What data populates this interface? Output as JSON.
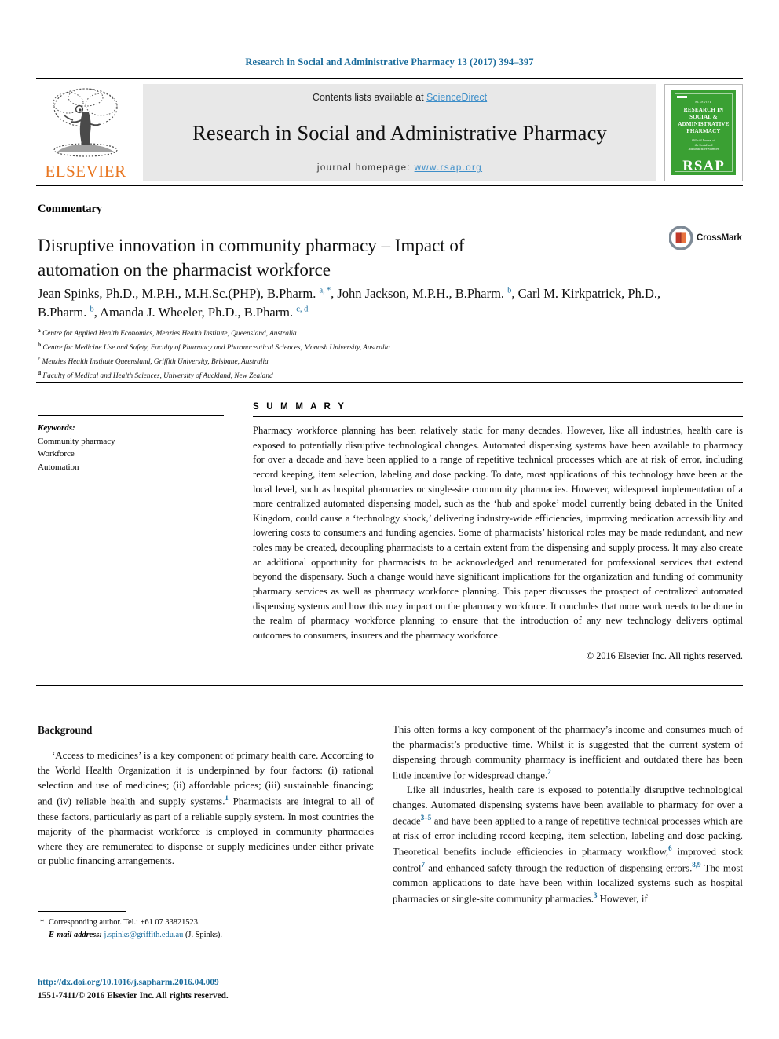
{
  "running_head": "Research in Social and Administrative Pharmacy 13 (2017) 394–397",
  "masthead": {
    "publisher_name": "ELSEVIER",
    "contents_prefix": "Contents lists available at ",
    "contents_link": "ScienceDirect",
    "journal_title": "Research in Social and Administrative Pharmacy",
    "homepage_prefix": "journal homepage: ",
    "homepage_url": "www.rsap.org",
    "cover": {
      "journal_line": "RESEARCH IN SOCIAL & ADMINISTRATIVE PHARMACY",
      "publisher_small": "ELSEVIER",
      "subtitle": "Official Journal of\nthe Social and\nAdministrative Sciences",
      "acronym": "RSAP"
    }
  },
  "article": {
    "type": "Commentary",
    "title": "Disruptive innovation in community pharmacy – Impact of automation on the pharmacist workforce",
    "crossmark_label": "CrossMark",
    "authors_html": "Jean Spinks, Ph.D., M.P.H., M.H.Sc.(PHP), B.Pharm. <sup>a, *</sup>, John Jackson, M.P.H., B.Pharm. <sup>b</sup>, Carl M. Kirkpatrick, Ph.D., B.Pharm. <sup>b</sup>, Amanda J. Wheeler, Ph.D., B.Pharm. <sup>c,&nbsp;d</sup>",
    "affiliations": [
      {
        "marker": "a",
        "text": "Centre for Applied Health Economics, Menzies Health Institute, Queensland, Australia"
      },
      {
        "marker": "b",
        "text": "Centre for Medicine Use and Safety, Faculty of Pharmacy and Pharmaceutical Sciences, Monash University, Australia"
      },
      {
        "marker": "c",
        "text": "Menzies Health Institute Queensland, Griffith University, Brisbane, Australia"
      },
      {
        "marker": "d",
        "text": "Faculty of Medical and Health Sciences, University of Auckland, New Zealand"
      }
    ]
  },
  "keywords": {
    "heading": "Keywords:",
    "items": [
      "Community pharmacy",
      "Workforce",
      "Automation"
    ]
  },
  "summary": {
    "heading": "S U M M A R Y",
    "text": "Pharmacy workforce planning has been relatively static for many decades. However, like all industries, health care is exposed to potentially disruptive technological changes. Automated dispensing systems have been available to pharmacy for over a decade and have been applied to a range of repetitive technical processes which are at risk of error, including record keeping, item selection, labeling and dose packing. To date, most applications of this technology have been at the local level, such as hospital pharmacies or single-site community pharmacies. However, widespread implementation of a more centralized automated dispensing model, such as the ‘hub and spoke’ model currently being debated in the United Kingdom, could cause a ‘technology shock,’ delivering industry-wide efficiencies, improving medication accessibility and lowering costs to consumers and funding agencies. Some of pharmacists’ historical roles may be made redundant, and new roles may be created, decoupling pharmacists to a certain extent from the dispensing and supply process. It may also create an additional opportunity for pharmacists to be acknowledged and renumerated for professional services that extend beyond the dispensary. Such a change would have significant implications for the organization and funding of community pharmacy services as well as pharmacy workforce planning. This paper discusses the prospect of centralized automated dispensing systems and how this may impact on the pharmacy workforce. It concludes that more work needs to be done in the realm of pharmacy workforce planning to ensure that the introduction of any new technology delivers optimal outcomes to consumers, insurers and the pharmacy workforce.",
    "copyright": "© 2016 Elsevier Inc. All rights reserved."
  },
  "body": {
    "section_heading": "Background",
    "left_paragraphs": [
      "‘Access to medicines’ is a key component of primary health care. According to the World Health Organization it is underpinned by four factors: (i) rational selection and use of medicines; (ii) affordable prices; (iii) sustainable financing; and (iv) reliable health and supply systems.<sup>1</sup> Pharmacists are integral to all of these factors, particularly as part of a reliable supply system. In most countries the majority of the pharmacist workforce is employed in community pharmacies where they are remunerated to dispense or supply medicines under either private or public financing arrangements."
    ],
    "right_paragraphs": [
      "This often forms a key component of the pharmacy’s income and consumes much of the pharmacist’s productive time. Whilst it is suggested that the current system of dispensing through community pharmacy is inefficient and outdated there has been little incentive for widespread change.<sup>2</sup>",
      "Like all industries, health care is exposed to potentially disruptive technological changes. Automated dispensing systems have been available to pharmacy for over a decade<sup>3–5</sup> and have been applied to a range of repetitive technical processes which are at risk of error including record keeping, item selection, labeling and dose packing. Theoretical benefits include efficiencies in pharmacy workflow,<sup>6</sup> improved stock control<sup>7</sup> and enhanced safety through the reduction of dispensing errors.<sup>8,9</sup> The most common applications to date have been within localized systems such as hospital pharmacies or single-site community pharmacies.<sup>3</sup> However, if"
    ]
  },
  "footnotes": {
    "corresponding": "Corresponding author. Tel.: +61 07 33821523.",
    "email_label": "E-mail address:",
    "email": "j.spinks@griffith.edu.au",
    "email_suffix": "(J. Spinks).",
    "doi": "http://dx.doi.org/10.1016/j.sapharm.2016.04.009",
    "issn_line": "1551-7411/© 2016 Elsevier Inc. All rights reserved."
  },
  "colors": {
    "link_blue": "#1a6c9c",
    "sciencedirect_blue": "#3d8ec9",
    "elsevier_orange": "#e87722",
    "cover_green": "#3aa033"
  }
}
